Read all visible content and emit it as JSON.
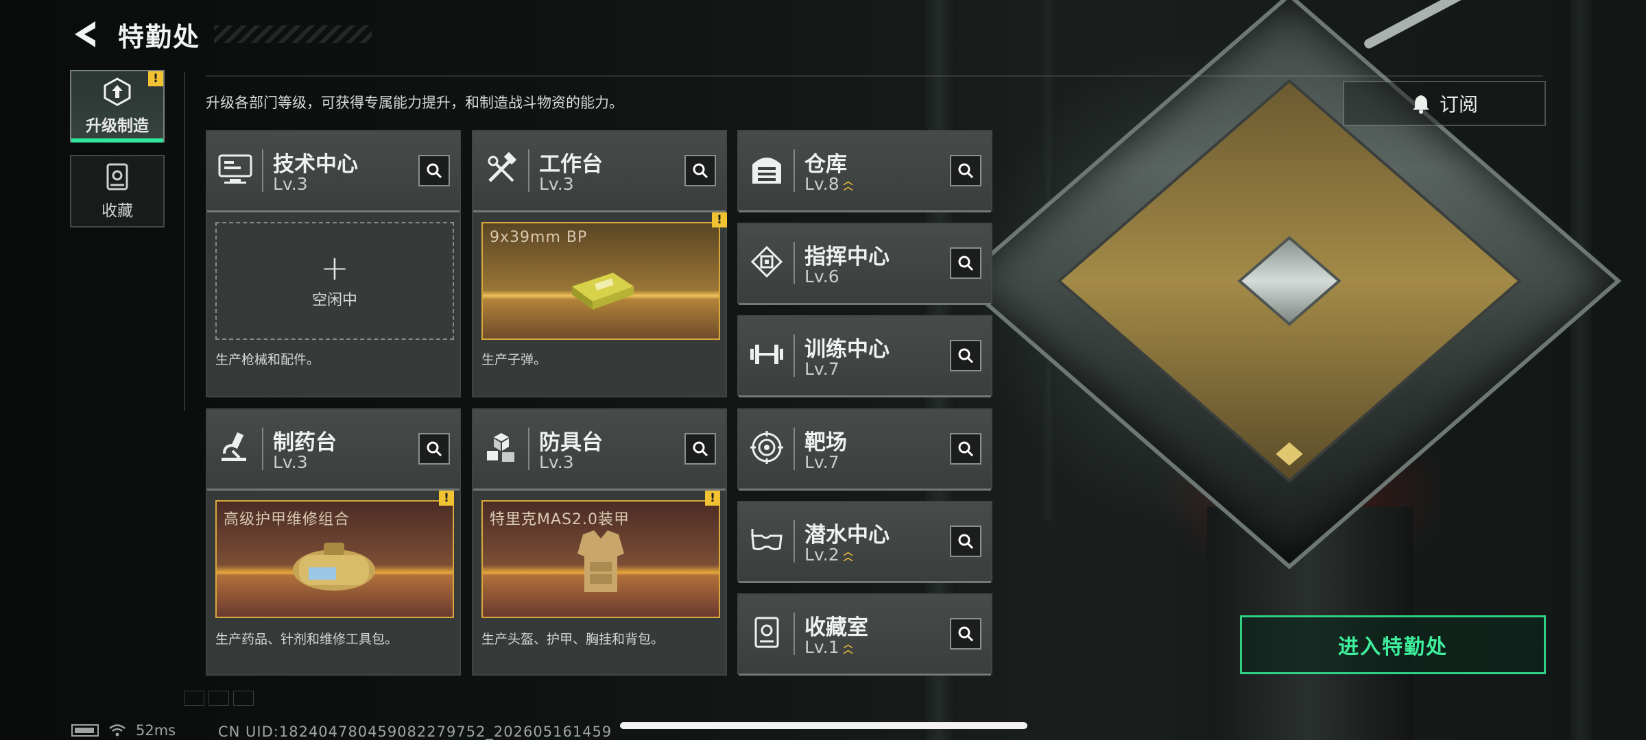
{
  "header": {
    "title": "特勤处"
  },
  "nav": {
    "items": [
      {
        "label": "升级制造",
        "active": true,
        "badge": "!"
      },
      {
        "label": "收藏",
        "active": false
      }
    ]
  },
  "subtitle": "升级各部门等级，可获得专属能力提升，和制造战斗物资的能力。",
  "cards": {
    "tech": {
      "name": "技术中心",
      "level": "Lv.3",
      "idle_label": "空闲中",
      "desc": "生产枪械和配件。"
    },
    "workbench": {
      "name": "工作台",
      "level": "Lv.3",
      "product": "9x39mm BP",
      "badge": "!",
      "desc": "生产子弹。"
    },
    "pharmacy": {
      "name": "制药台",
      "level": "Lv.3",
      "product": "高级护甲维修组合",
      "badge": "!",
      "desc": "生产药品、针剂和维修工具包。"
    },
    "armor": {
      "name": "防具台",
      "level": "Lv.3",
      "product": "特里克MAS2.0装甲",
      "badge": "!",
      "desc": "生产头盔、护甲、胸挂和背包。"
    },
    "warehouse": {
      "name": "仓库",
      "level": "Lv.8",
      "upgradable": true
    },
    "command": {
      "name": "指挥中心",
      "level": "Lv.6"
    },
    "training": {
      "name": "训练中心",
      "level": "Lv.7"
    },
    "range": {
      "name": "靶场",
      "level": "Lv.7"
    },
    "diving": {
      "name": "潜水中心",
      "level": "Lv.2",
      "upgradable": true
    },
    "collection": {
      "name": "收藏室",
      "level": "Lv.1",
      "upgradable": true
    }
  },
  "buttons": {
    "subscribe": "订阅",
    "enter": "进入特勤处"
  },
  "status": {
    "ping": "52ms",
    "uid": "CN UID:18240478045908227975​2_202605161459"
  },
  "colors": {
    "accent": "#2fe89a",
    "badge": "#f1c232",
    "upgrade": "#e7b93a",
    "product_border": "#d9a83a"
  }
}
